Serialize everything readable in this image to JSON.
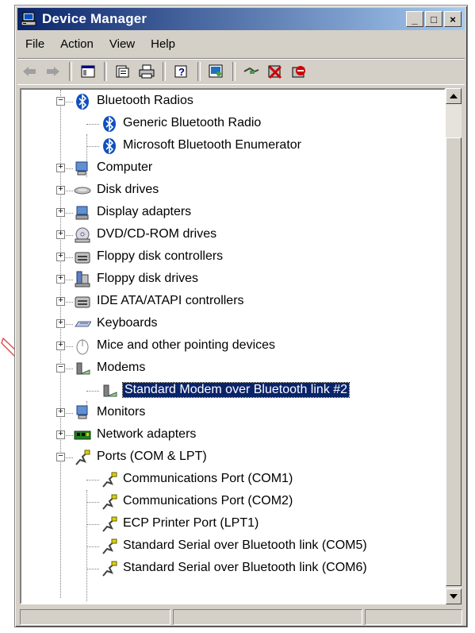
{
  "window": {
    "title": "Device Manager",
    "controls": [
      "_",
      "□",
      "×"
    ]
  },
  "menu": {
    "items": [
      "File",
      "Action",
      "View",
      "Help"
    ]
  },
  "toolbar": {
    "icons": [
      "back-icon",
      "forward-icon",
      "console-tree-icon",
      "properties-icon",
      "print-icon",
      "help-icon",
      "scan-hardware-icon",
      "update-driver-icon",
      "uninstall-icon",
      "disable-icon"
    ]
  },
  "tree": {
    "categories": [
      {
        "label": "Bluetooth Radios",
        "expanded": true,
        "icon": "bluetooth-icon",
        "children": [
          "Generic Bluetooth Radio",
          "Microsoft Bluetooth Enumerator"
        ]
      },
      {
        "label": "Computer",
        "expanded": false,
        "icon": "computer-icon"
      },
      {
        "label": "Disk drives",
        "expanded": false,
        "icon": "disk-drive-icon"
      },
      {
        "label": "Display adapters",
        "expanded": false,
        "icon": "display-adapter-icon"
      },
      {
        "label": "DVD/CD-ROM drives",
        "expanded": false,
        "icon": "cdrom-icon"
      },
      {
        "label": "Floppy disk controllers",
        "expanded": false,
        "icon": "controller-icon"
      },
      {
        "label": "Floppy disk drives",
        "expanded": false,
        "icon": "floppy-icon"
      },
      {
        "label": "IDE ATA/ATAPI controllers",
        "expanded": false,
        "icon": "controller-icon"
      },
      {
        "label": "Keyboards",
        "expanded": false,
        "icon": "keyboard-icon"
      },
      {
        "label": "Mice and other pointing devices",
        "expanded": false,
        "icon": "mouse-icon"
      },
      {
        "label": "Modems",
        "expanded": true,
        "icon": "modem-icon",
        "children": [
          "Standard Modem over Bluetooth link #2"
        ]
      },
      {
        "label": "Monitors",
        "expanded": false,
        "icon": "monitor-icon"
      },
      {
        "label": "Network adapters",
        "expanded": false,
        "icon": "network-adapter-icon"
      },
      {
        "label": "Ports (COM & LPT)",
        "expanded": true,
        "icon": "port-icon",
        "children": [
          "Communications Port (COM1)",
          "Communications Port (COM2)",
          "ECP Printer Port (LPT1)",
          "Standard Serial over Bluetooth link (COM5)",
          "Standard Serial over Bluetooth link (COM6)"
        ]
      }
    ],
    "selected": "Standard Modem over Bluetooth link #2"
  },
  "colors": {
    "title_gradient_start": "#0a246a",
    "title_gradient_end": "#a6caf0",
    "selection": "#0a246a",
    "annotation_arrow": "#e05050"
  }
}
